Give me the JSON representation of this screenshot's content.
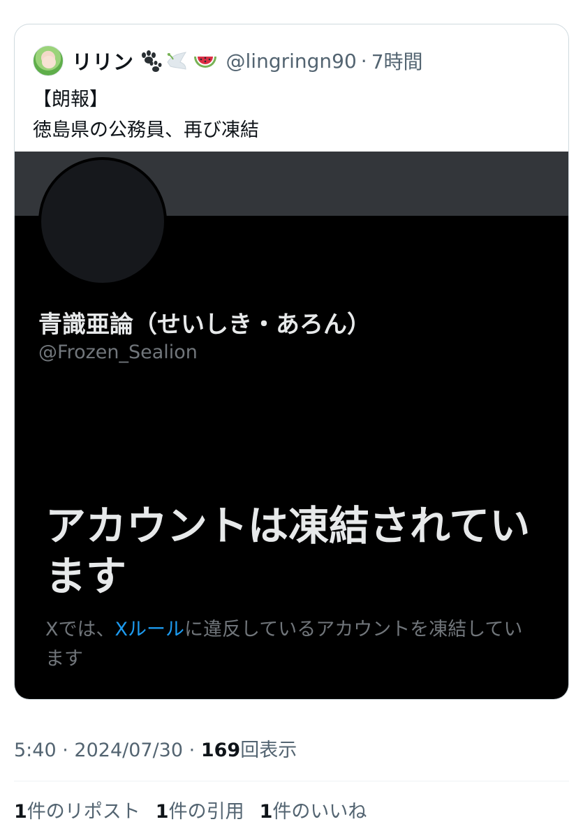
{
  "quote": {
    "display_name": "リリン",
    "emojis": [
      "paw-prints-icon",
      "dove-icon",
      "watermelon-icon"
    ],
    "handle": "@lingringn90",
    "separator": "·",
    "time_ago": "7時間",
    "text_line1": "【朗報】",
    "text_line2": "徳島県の公務員、再び凍結"
  },
  "media": {
    "profile_name": "青識亜論（せいしき・あろん）",
    "profile_handle": "@Frozen_Sealion",
    "suspended_heading": "アカウントは凍結されています",
    "body_prefix": "Xでは、",
    "rules_link": "Xルール",
    "body_suffix": "に違反しているアカウントを凍結しています"
  },
  "meta": {
    "time": "5:40",
    "sep": "·",
    "date": "2024/07/30",
    "views_count": "169",
    "views_label": "回表示"
  },
  "stats": {
    "reposts_count": "1",
    "reposts_label": "件のリポスト",
    "quotes_count": "1",
    "quotes_label": "件の引用",
    "likes_count": "1",
    "likes_label": "件のいいね"
  },
  "colors": {
    "link": "#1d9bf0",
    "secondary_text": "#536471",
    "media_bg": "#000000",
    "banner": "#33363a"
  }
}
